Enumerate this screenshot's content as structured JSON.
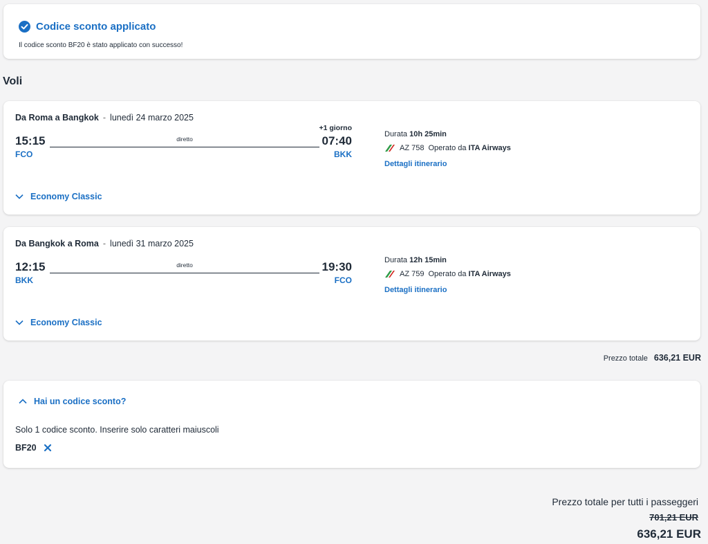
{
  "success": {
    "title": "Codice sconto applicato",
    "message": "Il codice sconto BF20 è stato applicato con successo!"
  },
  "section_title": "Voli",
  "flights": [
    {
      "route": "Da Roma a Bangkok",
      "date": "lunedì 24 marzo 2025",
      "dep_time": "15:15",
      "dep_code": "FCO",
      "arr_time": "07:40",
      "arr_code": "BKK",
      "plus_day": "+1 giorno",
      "stops": "diretto",
      "duration_label": "Durata",
      "duration": "10h 25min",
      "flight_number": "AZ 758",
      "operated_label": "Operato da",
      "airline": "ITA Airways",
      "details_link": "Dettagli itinerario",
      "cabin": "Economy Classic"
    },
    {
      "route": "Da Bangkok a Roma",
      "date": "lunedì 31 marzo 2025",
      "dep_time": "12:15",
      "dep_code": "BKK",
      "arr_time": "19:30",
      "arr_code": "FCO",
      "plus_day": "",
      "stops": "diretto",
      "duration_label": "Durata",
      "duration": "12h 15min",
      "flight_number": "AZ 759",
      "operated_label": "Operato da",
      "airline": "ITA Airways",
      "details_link": "Dettagli itinerario",
      "cabin": "Economy Classic"
    }
  ],
  "subtotal": {
    "label": "Prezzo totale",
    "value": "636,21 EUR"
  },
  "discount": {
    "toggle_label": "Hai un codice sconto?",
    "note": "Solo 1 codice sconto. Inserire solo caratteri maiuscoli",
    "code": "BF20"
  },
  "grand_total": {
    "label": "Prezzo totale per tutti i passeggeri",
    "old_price": "701,21 EUR",
    "new_price": "636,21 EUR"
  },
  "colors": {
    "accent": "#1a6fc4",
    "text": "#1f2a37",
    "background": "#f4f4f5",
    "airline_green": "#2e9b47",
    "airline_red": "#d0261e"
  }
}
